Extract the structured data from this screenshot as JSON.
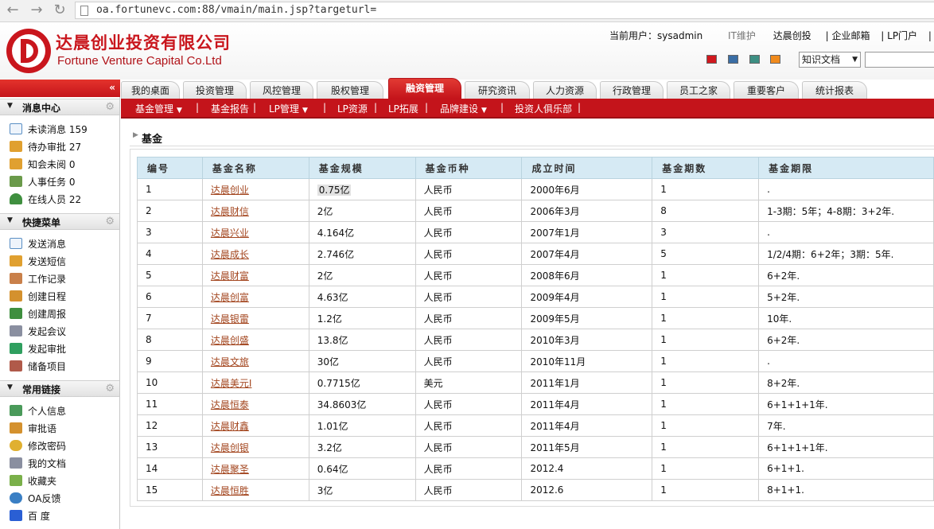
{
  "browser": {
    "url": "oa.fortunevc.com:88/vmain/main.jsp?targeturl="
  },
  "header": {
    "company_cn": "达晨创业投资有限公司",
    "company_en": "Fortune Venture Capital Co.Ltd",
    "current_user_label": "当前用户：sysadmin",
    "links": [
      "IT维护",
      "达晨创投",
      "| 企业邮箱",
      "| LP门户",
      "| "
    ],
    "theme_colors": [
      "#d0181e",
      "#3a6ea5",
      "#3d8f83",
      "#f08a1c"
    ],
    "knowledge_select": "知识文档"
  },
  "tabs": [
    {
      "label": "我的桌面"
    },
    {
      "label": "投资管理"
    },
    {
      "label": "风控管理"
    },
    {
      "label": "股权管理"
    },
    {
      "label": "融资管理"
    },
    {
      "label": "研究资讯"
    },
    {
      "label": "人力资源"
    },
    {
      "label": "行政管理"
    },
    {
      "label": "员工之家"
    },
    {
      "label": "重要客户"
    },
    {
      "label": "统计报表"
    }
  ],
  "subnav": [
    {
      "label": "基金管理",
      "dropdown": true
    },
    {
      "label": "基金报告",
      "dropdown": false
    },
    {
      "label": "LP管理",
      "dropdown": true
    },
    {
      "label": "LP资源",
      "dropdown": false
    },
    {
      "label": "LP拓展",
      "dropdown": false
    },
    {
      "label": "品牌建设",
      "dropdown": true
    },
    {
      "label": "投资人俱乐部",
      "dropdown": false
    }
  ],
  "sidebar": {
    "sections": [
      {
        "title": "消息中心",
        "items": [
          {
            "label": "未读消息 159",
            "icon": "mail-icon",
            "color": "#5a8fc4"
          },
          {
            "label": "待办审批 27",
            "icon": "edit-icon",
            "color": "#e0a030"
          },
          {
            "label": "知会未阅 0",
            "icon": "edit-icon",
            "color": "#e0a030"
          },
          {
            "label": "人事任务 0",
            "icon": "contact-card-icon",
            "color": "#6a9a4a"
          },
          {
            "label": "在线人员 22",
            "icon": "user-icon",
            "color": "#3f8f3f"
          }
        ]
      },
      {
        "title": "快捷菜单",
        "items": [
          {
            "label": "发送消息",
            "icon": "mail-icon",
            "color": "#5a8fc4"
          },
          {
            "label": "发送短信",
            "icon": "sms-icon",
            "color": "#e0a030"
          },
          {
            "label": "工作记录",
            "icon": "notebook-icon",
            "color": "#c9804a"
          },
          {
            "label": "创建日程",
            "icon": "calendar-icon",
            "color": "#d4912e"
          },
          {
            "label": "创建周报",
            "icon": "user-report-icon",
            "color": "#3f8f3f"
          },
          {
            "label": "发起会议",
            "icon": "meeting-icon",
            "color": "#8a8fa0"
          },
          {
            "label": "发起审批",
            "icon": "approve-icon",
            "color": "#2f9f5f"
          },
          {
            "label": "储备项目",
            "icon": "checklist-icon",
            "color": "#b05a4a"
          }
        ]
      },
      {
        "title": "常用链接",
        "items": [
          {
            "label": "个人信息",
            "icon": "id-card-icon",
            "color": "#4a9a5a"
          },
          {
            "label": "审批语",
            "icon": "pen-icon",
            "color": "#d4912e"
          },
          {
            "label": "修改密码",
            "icon": "lock-icon",
            "color": "#e0b030"
          },
          {
            "label": "我的文档",
            "icon": "document-icon",
            "color": "#8a8fa0"
          },
          {
            "label": "收藏夹",
            "icon": "favorites-icon",
            "color": "#7ab04a"
          },
          {
            "label": "OA反馈",
            "icon": "globe-icon",
            "color": "#3a7fc4"
          },
          {
            "label": "百 度",
            "icon": "paw-icon",
            "color": "#2a5fd4"
          }
        ]
      }
    ]
  },
  "panel": {
    "title": "基金"
  },
  "table": {
    "columns": [
      "编号",
      "基金名称",
      "基金规模",
      "基金币种",
      "成立时间",
      "基金期数",
      "基金期限"
    ],
    "rows": [
      [
        "1",
        "达晨创业",
        "0.75亿",
        "人民币",
        "2000年6月",
        "1",
        "."
      ],
      [
        "2",
        "达晨财信",
        "2亿",
        "人民币",
        "2006年3月",
        "8",
        "1-3期：5年；4-8期：3+2年."
      ],
      [
        "3",
        "达晨兴业",
        "4.164亿",
        "人民币",
        "2007年1月",
        "3",
        "."
      ],
      [
        "4",
        "达晨成长",
        "2.746亿",
        "人民币",
        "2007年4月",
        "5",
        "1/2/4期：6+2年；3期：5年."
      ],
      [
        "5",
        "达晨财富",
        "2亿",
        "人民币",
        "2008年6月",
        "1",
        "6+2年."
      ],
      [
        "6",
        "达晨创富",
        "4.63亿",
        "人民币",
        "2009年4月",
        "1",
        "5+2年."
      ],
      [
        "7",
        "达晨银雷",
        "1.2亿",
        "人民币",
        "2009年5月",
        "1",
        "10年."
      ],
      [
        "8",
        "达晨创盛",
        "13.8亿",
        "人民币",
        "2010年3月",
        "1",
        "6+2年."
      ],
      [
        "9",
        "达晨文旅",
        "30亿",
        "人民币",
        "2010年11月",
        "1",
        "."
      ],
      [
        "10",
        "达晨美元I",
        "0.7715亿",
        "美元",
        "2011年1月",
        "1",
        "8+2年."
      ],
      [
        "11",
        "达晨恒泰",
        "34.8603亿",
        "人民币",
        "2011年4月",
        "1",
        "6+1+1+1年."
      ],
      [
        "12",
        "达晨财鑫",
        "1.01亿",
        "人民币",
        "2011年4月",
        "1",
        "7年."
      ],
      [
        "13",
        "达晨创银",
        "3.2亿",
        "人民币",
        "2011年5月",
        "1",
        "6+1+1+1年."
      ],
      [
        "14",
        "达晨聚圣",
        "0.64亿",
        "人民币",
        "2012.4",
        "1",
        "6+1+1."
      ],
      [
        "15",
        "达晨恒胜",
        "3亿",
        "人民币",
        "2012.6",
        "1",
        "8+1+1."
      ]
    ]
  }
}
